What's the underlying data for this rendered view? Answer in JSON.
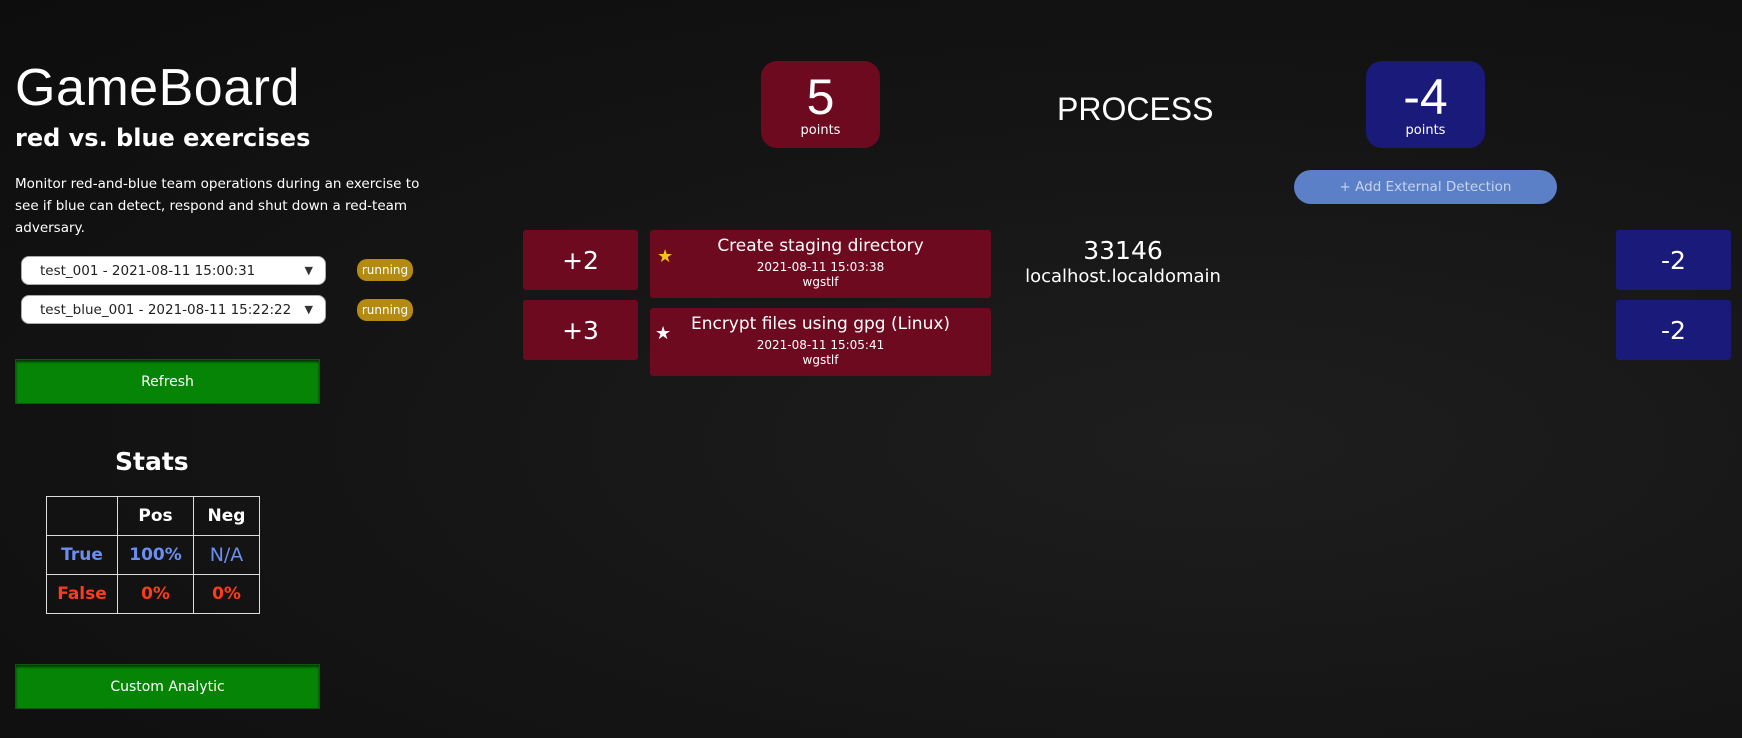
{
  "sidebar": {
    "title": "GameBoard",
    "subtitle": "red vs. blue exercises",
    "description": "Monitor red-and-blue team operations during an exercise to see if blue can detect, respond and shut down a red-team adversary.",
    "operations": [
      {
        "selected": "test_001 - 2021-08-11 15:00:31",
        "status": "running"
      },
      {
        "selected": "test_blue_001 - 2021-08-11 15:22:22",
        "status": "running"
      }
    ],
    "refresh_label": "Refresh",
    "custom_analytic_label": "Custom Analytic"
  },
  "stats": {
    "title": "Stats",
    "headers": [
      "",
      "Pos",
      "Neg"
    ],
    "rows": [
      {
        "label": "True",
        "pos": "100%",
        "neg": "N/A"
      },
      {
        "label": "False",
        "pos": "0%",
        "neg": "0%"
      }
    ]
  },
  "scoreboard": {
    "red_score": "5",
    "red_unit": "points",
    "mode": "PROCESS",
    "blue_score": "-4",
    "blue_unit": "points",
    "external_detection_label": "+ Add External Detection"
  },
  "host": {
    "pid": "33146",
    "name": "localhost.localdomain"
  },
  "links": [
    {
      "red_points": "+2",
      "ability": "Create staging directory",
      "timestamp": "2021-08-11 15:03:38",
      "user": "wgstlf",
      "star": "★",
      "star_color": "#f2c31a",
      "blue_points": "-2"
    },
    {
      "red_points": "+3",
      "ability": "Encrypt files using gpg (Linux)",
      "timestamp": "2021-08-11 15:05:41",
      "user": "wgstlf",
      "star": "★",
      "star_color": "#ffffff",
      "blue_points": "-2"
    }
  ],
  "colors": {
    "red_team": "#6e0a1f",
    "blue_team": "#1a1a7a",
    "green_button": "#068406",
    "badge": "#b58a10",
    "external_btn": "#5b80c8"
  }
}
